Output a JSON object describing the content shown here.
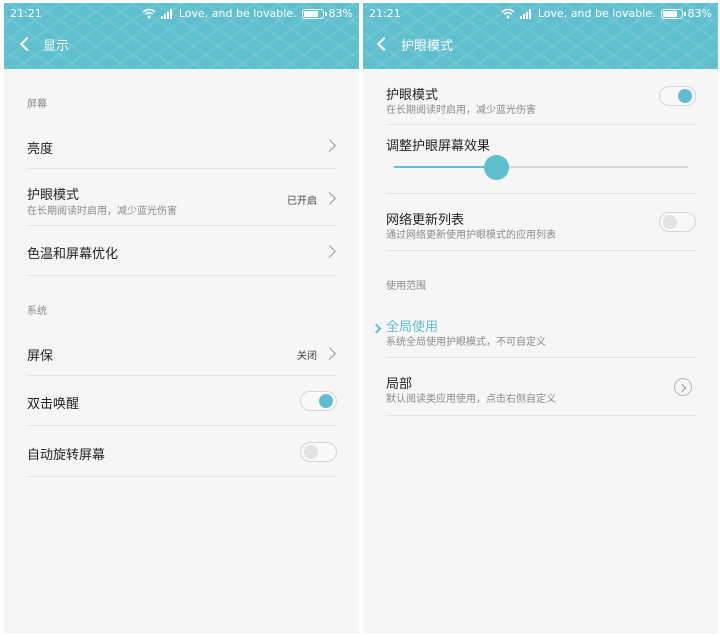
{
  "status_bar": {
    "time": "21:21",
    "carrier_text": "Love, and be lovable.",
    "battery_percent": "83%",
    "battery_level": 0.83
  },
  "display_screen": {
    "title": "显示",
    "sections": {
      "screen_label": "屏幕",
      "system_label": "系统"
    },
    "items": {
      "brightness": {
        "title": "亮度"
      },
      "eye_care": {
        "title": "护眼模式",
        "subtitle": "在长期阅读时启用，减少蓝光伤害",
        "value": "已开启"
      },
      "color_temp": {
        "title": "色温和屏幕优化"
      },
      "screensaver": {
        "title": "屏保",
        "value": "关闭"
      },
      "double_tap_wake": {
        "title": "双击唤醒",
        "enabled": true
      },
      "auto_rotate": {
        "title": "自动旋转屏幕",
        "enabled": false
      }
    }
  },
  "eye_care_screen": {
    "title": "护眼模式",
    "items": {
      "eye_care_toggle": {
        "title": "护眼模式",
        "subtitle": "在长期阅读时启用，减少蓝光伤害",
        "enabled": true
      },
      "effect_slider": {
        "title": "调整护眼屏幕效果",
        "level": 0.35
      },
      "network_update": {
        "title": "网络更新列表",
        "subtitle": "通过网络更新使用护眼模式的应用列表",
        "enabled": false
      }
    },
    "scope_label": "使用范围",
    "scope_options": {
      "global": {
        "title": "全局使用",
        "subtitle": "系统全局使用护眼模式，不可自定义",
        "selected": true
      },
      "partial": {
        "title": "局部",
        "subtitle": "默认阅读类应用使用，点击右侧自定义",
        "selected": false
      }
    }
  },
  "colors": {
    "accent": "#5fbfce",
    "background": "#f6f6f6",
    "divider": "#e3e3e3"
  }
}
